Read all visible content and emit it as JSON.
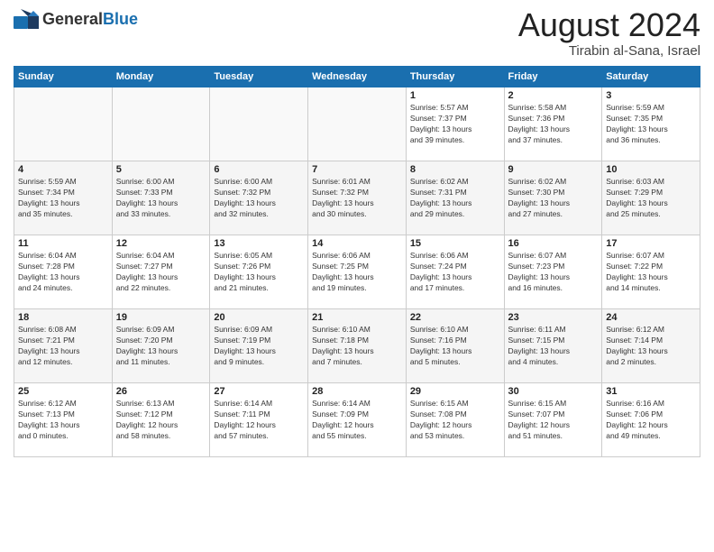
{
  "header": {
    "logo_general": "General",
    "logo_blue": "Blue",
    "month_year": "August 2024",
    "location": "Tirabin al-Sana, Israel"
  },
  "days_of_week": [
    "Sunday",
    "Monday",
    "Tuesday",
    "Wednesday",
    "Thursday",
    "Friday",
    "Saturday"
  ],
  "weeks": [
    [
      {
        "day": "",
        "detail": ""
      },
      {
        "day": "",
        "detail": ""
      },
      {
        "day": "",
        "detail": ""
      },
      {
        "day": "",
        "detail": ""
      },
      {
        "day": "1",
        "detail": "Sunrise: 5:57 AM\nSunset: 7:37 PM\nDaylight: 13 hours\nand 39 minutes."
      },
      {
        "day": "2",
        "detail": "Sunrise: 5:58 AM\nSunset: 7:36 PM\nDaylight: 13 hours\nand 37 minutes."
      },
      {
        "day": "3",
        "detail": "Sunrise: 5:59 AM\nSunset: 7:35 PM\nDaylight: 13 hours\nand 36 minutes."
      }
    ],
    [
      {
        "day": "4",
        "detail": "Sunrise: 5:59 AM\nSunset: 7:34 PM\nDaylight: 13 hours\nand 35 minutes."
      },
      {
        "day": "5",
        "detail": "Sunrise: 6:00 AM\nSunset: 7:33 PM\nDaylight: 13 hours\nand 33 minutes."
      },
      {
        "day": "6",
        "detail": "Sunrise: 6:00 AM\nSunset: 7:32 PM\nDaylight: 13 hours\nand 32 minutes."
      },
      {
        "day": "7",
        "detail": "Sunrise: 6:01 AM\nSunset: 7:32 PM\nDaylight: 13 hours\nand 30 minutes."
      },
      {
        "day": "8",
        "detail": "Sunrise: 6:02 AM\nSunset: 7:31 PM\nDaylight: 13 hours\nand 29 minutes."
      },
      {
        "day": "9",
        "detail": "Sunrise: 6:02 AM\nSunset: 7:30 PM\nDaylight: 13 hours\nand 27 minutes."
      },
      {
        "day": "10",
        "detail": "Sunrise: 6:03 AM\nSunset: 7:29 PM\nDaylight: 13 hours\nand 25 minutes."
      }
    ],
    [
      {
        "day": "11",
        "detail": "Sunrise: 6:04 AM\nSunset: 7:28 PM\nDaylight: 13 hours\nand 24 minutes."
      },
      {
        "day": "12",
        "detail": "Sunrise: 6:04 AM\nSunset: 7:27 PM\nDaylight: 13 hours\nand 22 minutes."
      },
      {
        "day": "13",
        "detail": "Sunrise: 6:05 AM\nSunset: 7:26 PM\nDaylight: 13 hours\nand 21 minutes."
      },
      {
        "day": "14",
        "detail": "Sunrise: 6:06 AM\nSunset: 7:25 PM\nDaylight: 13 hours\nand 19 minutes."
      },
      {
        "day": "15",
        "detail": "Sunrise: 6:06 AM\nSunset: 7:24 PM\nDaylight: 13 hours\nand 17 minutes."
      },
      {
        "day": "16",
        "detail": "Sunrise: 6:07 AM\nSunset: 7:23 PM\nDaylight: 13 hours\nand 16 minutes."
      },
      {
        "day": "17",
        "detail": "Sunrise: 6:07 AM\nSunset: 7:22 PM\nDaylight: 13 hours\nand 14 minutes."
      }
    ],
    [
      {
        "day": "18",
        "detail": "Sunrise: 6:08 AM\nSunset: 7:21 PM\nDaylight: 13 hours\nand 12 minutes."
      },
      {
        "day": "19",
        "detail": "Sunrise: 6:09 AM\nSunset: 7:20 PM\nDaylight: 13 hours\nand 11 minutes."
      },
      {
        "day": "20",
        "detail": "Sunrise: 6:09 AM\nSunset: 7:19 PM\nDaylight: 13 hours\nand 9 minutes."
      },
      {
        "day": "21",
        "detail": "Sunrise: 6:10 AM\nSunset: 7:18 PM\nDaylight: 13 hours\nand 7 minutes."
      },
      {
        "day": "22",
        "detail": "Sunrise: 6:10 AM\nSunset: 7:16 PM\nDaylight: 13 hours\nand 5 minutes."
      },
      {
        "day": "23",
        "detail": "Sunrise: 6:11 AM\nSunset: 7:15 PM\nDaylight: 13 hours\nand 4 minutes."
      },
      {
        "day": "24",
        "detail": "Sunrise: 6:12 AM\nSunset: 7:14 PM\nDaylight: 13 hours\nand 2 minutes."
      }
    ],
    [
      {
        "day": "25",
        "detail": "Sunrise: 6:12 AM\nSunset: 7:13 PM\nDaylight: 13 hours\nand 0 minutes."
      },
      {
        "day": "26",
        "detail": "Sunrise: 6:13 AM\nSunset: 7:12 PM\nDaylight: 12 hours\nand 58 minutes."
      },
      {
        "day": "27",
        "detail": "Sunrise: 6:14 AM\nSunset: 7:11 PM\nDaylight: 12 hours\nand 57 minutes."
      },
      {
        "day": "28",
        "detail": "Sunrise: 6:14 AM\nSunset: 7:09 PM\nDaylight: 12 hours\nand 55 minutes."
      },
      {
        "day": "29",
        "detail": "Sunrise: 6:15 AM\nSunset: 7:08 PM\nDaylight: 12 hours\nand 53 minutes."
      },
      {
        "day": "30",
        "detail": "Sunrise: 6:15 AM\nSunset: 7:07 PM\nDaylight: 12 hours\nand 51 minutes."
      },
      {
        "day": "31",
        "detail": "Sunrise: 6:16 AM\nSunset: 7:06 PM\nDaylight: 12 hours\nand 49 minutes."
      }
    ]
  ]
}
